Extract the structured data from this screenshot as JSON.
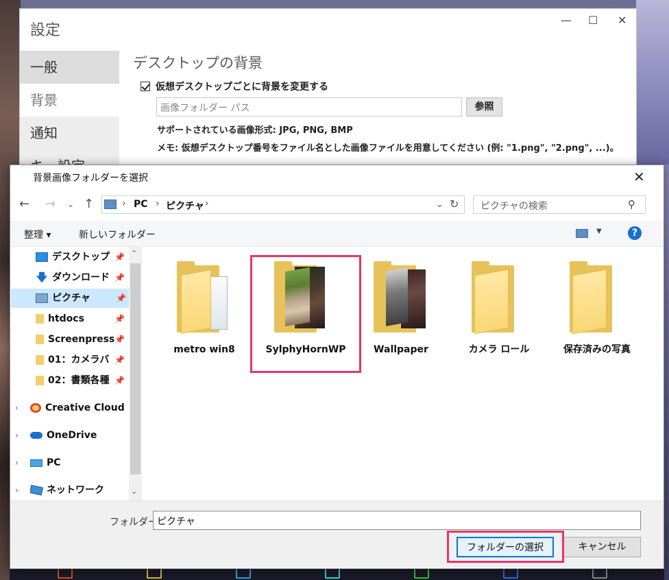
{
  "settings": {
    "title": "設定",
    "sidebar": [
      {
        "label": "一般"
      },
      {
        "label": "背景"
      },
      {
        "label": "通知"
      },
      {
        "label": "キー設定"
      }
    ],
    "section_title": "デスクトップの背景",
    "checkbox_label": "仮想デスクトップごとに背景を変更する",
    "path_placeholder": "画像フォルダー パス",
    "browse_label": "参照",
    "supported_formats": "サポートされている画像形式: JPG, PNG, BMP",
    "memo": "メモ: 仮想デスクトップ番号をファイル名とした画像ファイルを用意してください (例: \"1.png\", \"2.png\", ...)。"
  },
  "dialog": {
    "title": "背景画像フォルダーを選択",
    "breadcrumb": [
      "PC",
      "ピクチャ"
    ],
    "search_placeholder": "ピクチャの検索",
    "toolbar": {
      "organize": "整理 ▾",
      "new_folder": "新しいフォルダー"
    },
    "nav_items": [
      {
        "label": "デスクトップ",
        "icon": "desktop-icon",
        "pinned": true
      },
      {
        "label": "ダウンロード",
        "icon": "download-icon",
        "pinned": true
      },
      {
        "label": "ピクチャ",
        "icon": "pictures-icon",
        "pinned": true,
        "selected": true
      },
      {
        "label": "htdocs",
        "icon": "folder-icon",
        "pinned": true
      },
      {
        "label": "Screenpress",
        "icon": "folder-icon",
        "pinned": true
      },
      {
        "label": "01：カメラバ",
        "icon": "folder-icon",
        "pinned": true
      },
      {
        "label": "02：書類各種",
        "icon": "folder-icon",
        "pinned": true
      }
    ],
    "nav_roots": [
      {
        "label": "Creative Cloud",
        "icon": "creative-cloud-icon"
      },
      {
        "label": "OneDrive",
        "icon": "onedrive-icon"
      },
      {
        "label": "PC",
        "icon": "pc-icon"
      },
      {
        "label": "ネットワーク",
        "icon": "network-icon"
      }
    ],
    "folders": [
      {
        "name": "metro win8"
      },
      {
        "name": "SylphyHornWP",
        "selected": true
      },
      {
        "name": "Wallpaper"
      },
      {
        "name": "カメラ ロール"
      },
      {
        "name": "保存済みの写真"
      }
    ],
    "folder_field_label": "フォルダー:",
    "folder_field_value": "ピクチャ",
    "select_button": "フォルダーの選択",
    "cancel_button": "キャンセル"
  },
  "colors": {
    "highlight": "#e5376c",
    "accent": "#0078d7",
    "selection": "#cce8ff"
  }
}
